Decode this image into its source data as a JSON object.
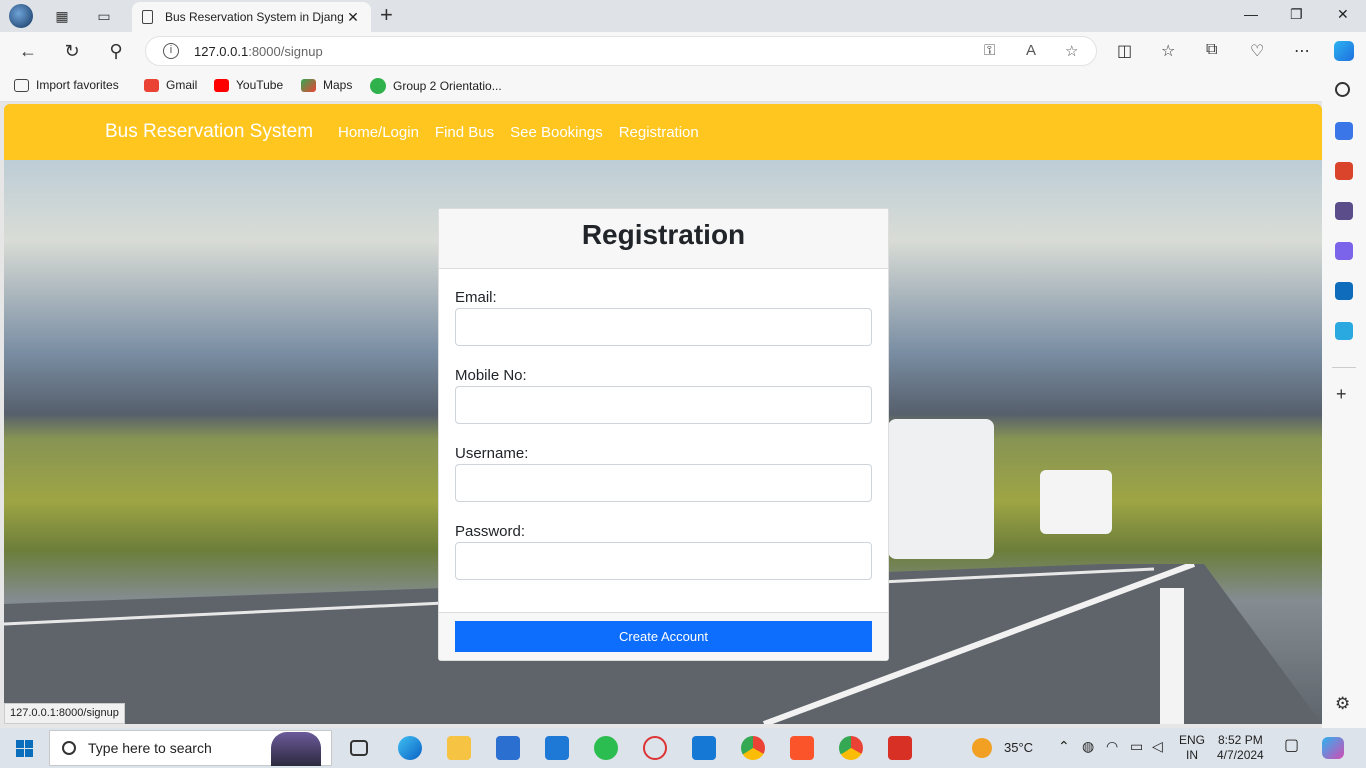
{
  "browser": {
    "tab_title": "Bus Reservation System in Djang",
    "url_host": "127.0.0.1",
    "url_rest": ":8000/signup",
    "favorites": [
      "Import favorites",
      "Gmail",
      "YouTube",
      "Maps",
      "Group 2 Orientatio..."
    ],
    "status_url": "127.0.0.1:8000/signup"
  },
  "site": {
    "brand": "Bus Reservation System",
    "nav": [
      "Home/Login",
      "Find Bus",
      "See Bookings",
      "Registration"
    ]
  },
  "form": {
    "title": "Registration",
    "labels": {
      "email": "Email:",
      "mobile": "Mobile No:",
      "username": "Username:",
      "password": "Password:"
    },
    "submit": "Create Account"
  },
  "taskbar": {
    "search_placeholder": "Type here to search",
    "temperature": "35°C",
    "lang_1": "ENG",
    "lang_2": "IN",
    "time": "8:52 PM",
    "date": "4/7/2024"
  }
}
